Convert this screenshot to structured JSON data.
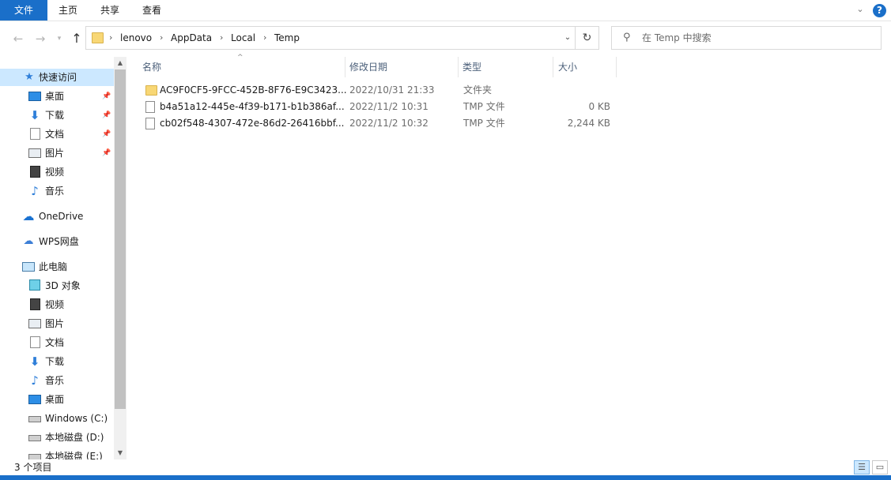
{
  "ribbon": {
    "tabs": [
      "文件",
      "主页",
      "共享",
      "查看"
    ]
  },
  "address": {
    "crumbs": [
      "lenovo",
      "AppData",
      "Local",
      "Temp"
    ],
    "separator": "›"
  },
  "search": {
    "placeholder": "在 Temp 中搜索"
  },
  "navigation": {
    "quick_access": "快速访问",
    "quick_items": [
      "桌面",
      "下载",
      "文档",
      "图片",
      "视频",
      "音乐"
    ],
    "onedrive": "OneDrive",
    "wps": "WPS网盘",
    "this_pc": "此电脑",
    "pc_items": [
      "3D 对象",
      "视频",
      "图片",
      "文档",
      "下载",
      "音乐",
      "桌面",
      "Windows (C:)",
      "本地磁盘 (D:)",
      "本地磁盘 (E:)"
    ]
  },
  "columns": {
    "name": "名称",
    "date": "修改日期",
    "type": "类型",
    "size": "大小"
  },
  "files": [
    {
      "name": "AC9F0CF5-9FCC-452B-8F76-E9C3423...",
      "date": "2022/10/31 21:33",
      "type": "文件夹",
      "size": ""
    },
    {
      "name": "b4a51a12-445e-4f39-b171-b1b386af...",
      "date": "2022/11/2 10:31",
      "type": "TMP 文件",
      "size": "0 KB"
    },
    {
      "name": "cb02f548-4307-472e-86d2-26416bbf...",
      "date": "2022/11/2 10:32",
      "type": "TMP 文件",
      "size": "2,244 KB"
    }
  ],
  "status": {
    "item_count": "3 个项目"
  },
  "colors": {
    "accent": "#1a6fc9",
    "selection": "#cce8ff",
    "folder": "#f8d775"
  }
}
